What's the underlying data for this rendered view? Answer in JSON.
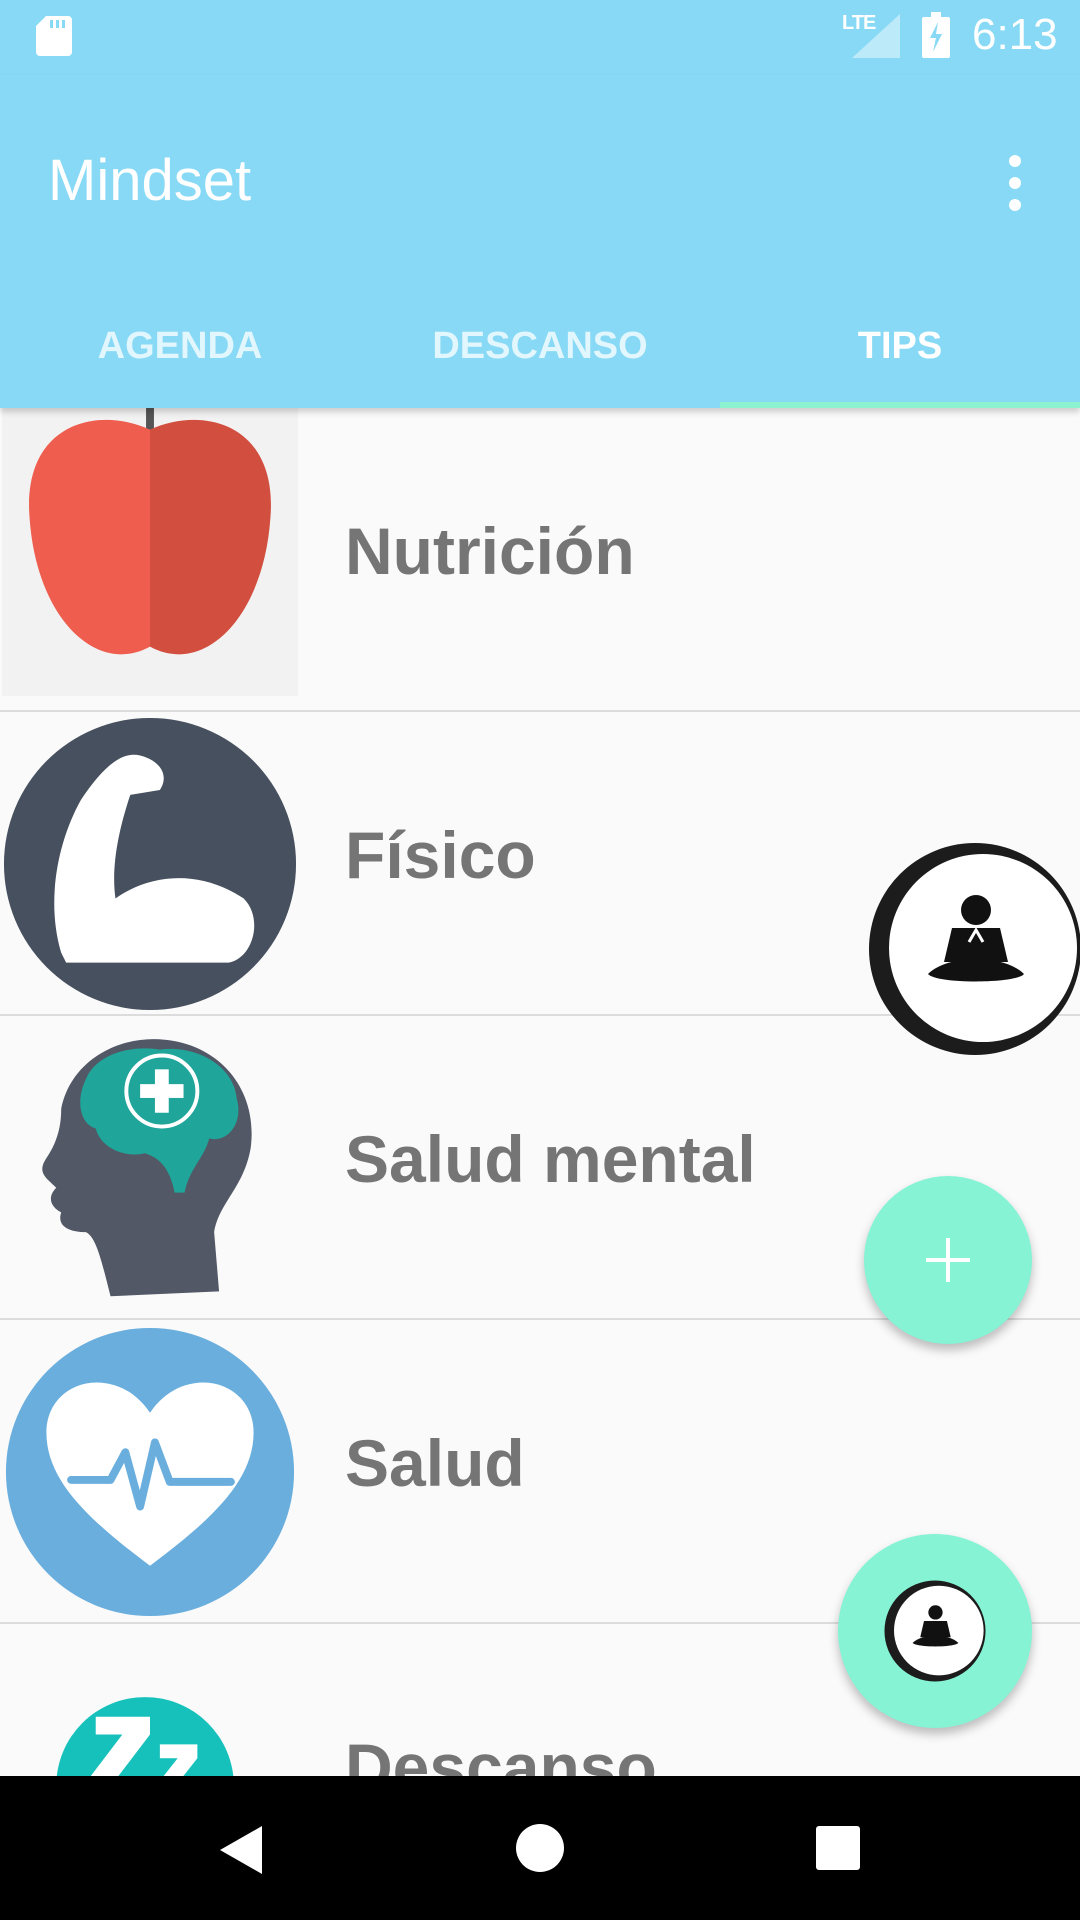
{
  "status_bar": {
    "time": "6:13",
    "network": "LTE",
    "icons": [
      "sd-card-icon",
      "signal-icon",
      "battery-charging-icon"
    ]
  },
  "app_bar": {
    "title": "Mindset",
    "overflow_icon": "more-vert-icon"
  },
  "tabs": [
    {
      "label": "AGENDA",
      "active": false
    },
    {
      "label": "DESCANSO",
      "active": false
    },
    {
      "label": "TIPS",
      "active": true
    }
  ],
  "tips": [
    {
      "label": "Nutrición",
      "icon": "apple-icon"
    },
    {
      "label": "Físico",
      "icon": "flexed-arm-icon"
    },
    {
      "label": "Salud mental",
      "icon": "brain-health-icon"
    },
    {
      "label": "Salud",
      "icon": "heartbeat-icon"
    },
    {
      "label": "Descanso",
      "icon": "sleep-zzz-icon"
    }
  ],
  "fabs": [
    {
      "icon": "meditation-icon"
    },
    {
      "icon": "add-icon"
    },
    {
      "icon": "meditation-icon"
    }
  ],
  "nav_bar": {
    "icons": [
      "back-icon",
      "home-icon",
      "recents-icon"
    ]
  },
  "colors": {
    "app_bar": "#87d9f5",
    "accent": "#86f3d4",
    "list_text": "#757575"
  }
}
